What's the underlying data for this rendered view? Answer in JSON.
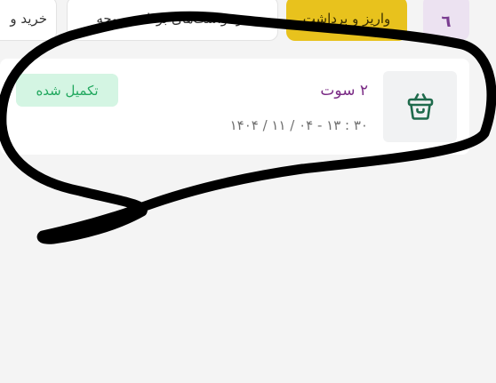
{
  "tabs": {
    "buy_label": "خرید و",
    "requests_label": "درخواست‌های برداشت وجه",
    "active_label": "واریز و برداشت",
    "icon_glyph": "٦"
  },
  "transaction": {
    "title": "۲ سوت",
    "datetime": "۱۴۰۴ / ۱۱ / ۰۴ - ۱۳ : ۳۰",
    "status": "تکمیل شده",
    "icon": "basket-icon"
  },
  "colors": {
    "active_tab": "#e8c21d",
    "title": "#7a2b85",
    "status_bg": "#d4f5e3",
    "status_text": "#22a85f",
    "icon_stroke": "#1f6b4c"
  }
}
